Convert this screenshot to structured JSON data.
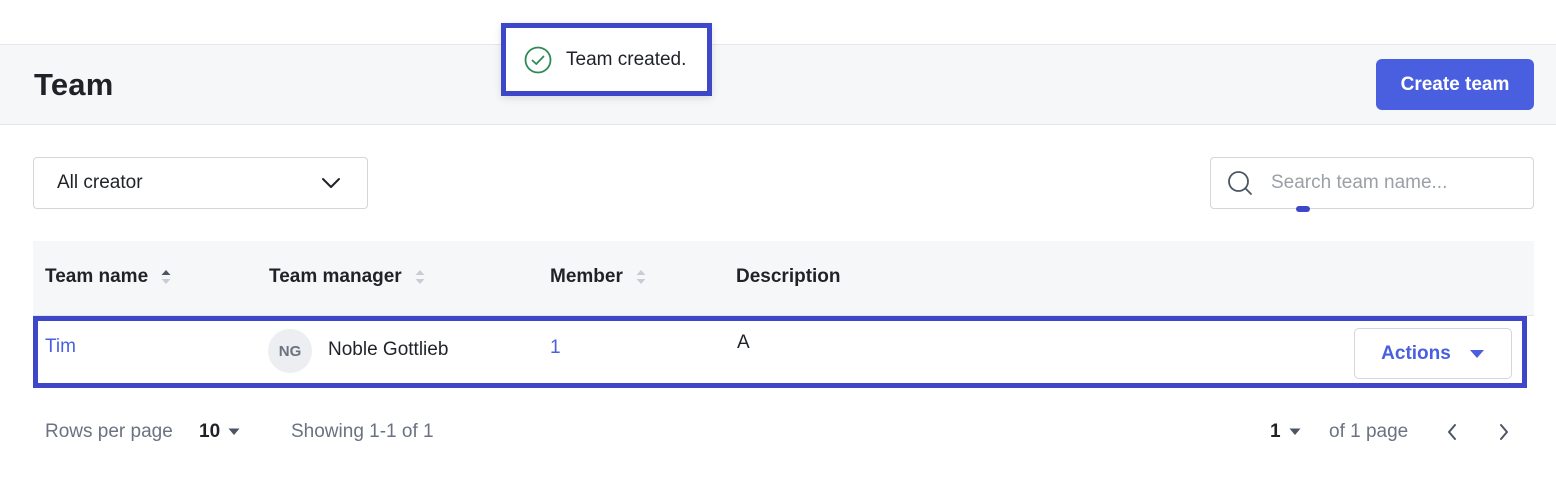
{
  "header": {
    "title": "Team",
    "create_label": "Create team"
  },
  "toast": {
    "message": "Team created.",
    "icon": "check-circle-icon",
    "color": "#2e8b57"
  },
  "filters": {
    "creator_value": "All creator",
    "search_placeholder": "Search team name..."
  },
  "table": {
    "columns": [
      {
        "label": "Team name",
        "sortable": true
      },
      {
        "label": "Team manager",
        "sortable": true
      },
      {
        "label": "Member",
        "sortable": true
      },
      {
        "label": "Description",
        "sortable": false
      }
    ],
    "rows": [
      {
        "team_name": "Tim",
        "manager_initials": "NG",
        "manager_name": "Noble Gottlieb",
        "members": "1",
        "description": "A",
        "actions_label": "Actions"
      }
    ]
  },
  "pagination": {
    "rows_per_page_label": "Rows per page",
    "rows_per_page_value": "10",
    "showing": "Showing 1-1 of 1",
    "current_page": "1",
    "of_pages": "of 1 page"
  },
  "colors": {
    "accent": "#4a5fe0",
    "highlight": "#3f47c9",
    "header_bg": "#f6f7f9"
  }
}
